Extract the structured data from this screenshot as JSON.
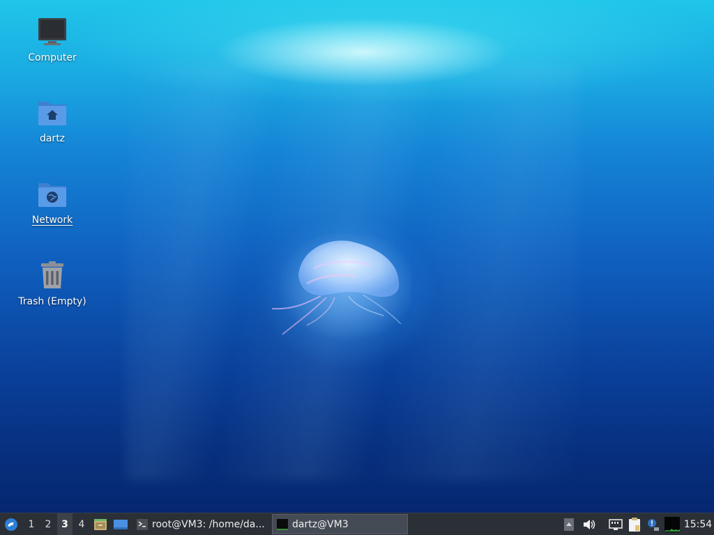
{
  "desktop": {
    "icons": [
      {
        "label": "Computer",
        "icon": "computer-icon"
      },
      {
        "label": "dartz",
        "icon": "home-folder-icon"
      },
      {
        "label": "Network",
        "icon": "network-folder-icon"
      },
      {
        "label": "Trash (Empty)",
        "icon": "trash-icon"
      }
    ]
  },
  "taskbar": {
    "menu_icon": "whisker-menu-icon",
    "workspaces": [
      "1",
      "2",
      "3",
      "4"
    ],
    "active_workspace": "3",
    "launchers": [
      "file-manager-icon",
      "show-desktop-icon"
    ],
    "tasks": [
      {
        "label": "root@VM3: /home/da...",
        "icon": "terminal-icon",
        "active": false
      },
      {
        "label": "dartz@VM3",
        "icon": "terminal-icon",
        "active": true
      }
    ],
    "tray": [
      "scroll-up-icon",
      "volume-icon",
      "network-icon",
      "clipboard-icon",
      "notification-icon",
      "system-monitor-icon"
    ],
    "clock": "15:54"
  }
}
